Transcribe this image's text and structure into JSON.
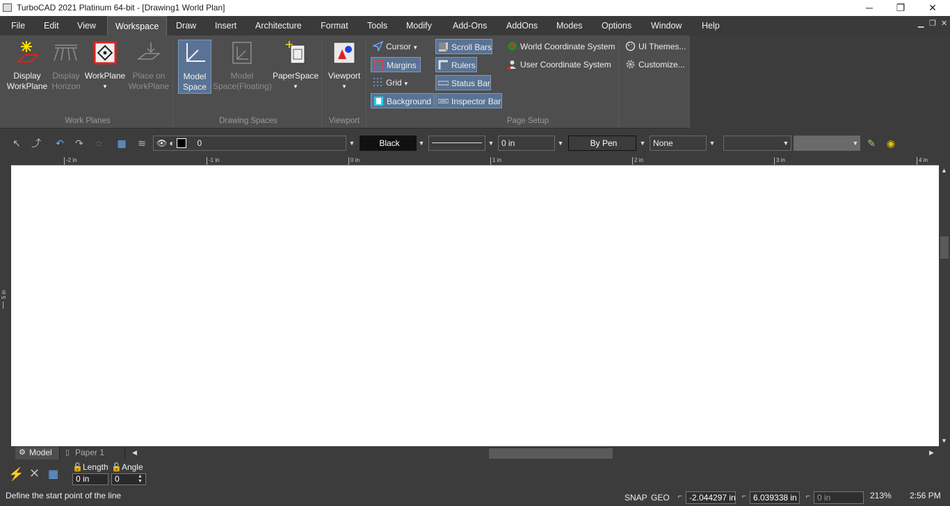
{
  "window": {
    "title": "TurboCAD 2021 Platinum 64-bit - [Drawing1 World Plan]",
    "minimize": "─",
    "restore": "❐",
    "close": "✕"
  },
  "menu": {
    "items": [
      "File",
      "Edit",
      "View",
      "Workspace",
      "Draw",
      "Insert",
      "Architecture",
      "Format",
      "Tools",
      "Modify",
      "Add-Ons",
      "AddOns",
      "Modes",
      "Options",
      "Window",
      "Help"
    ],
    "active": "Workspace"
  },
  "ribbon": {
    "groups": {
      "work_planes": "Work Planes",
      "drawing_spaces": "Drawing Spaces",
      "viewport": "Viewport",
      "page_setup": "Page Setup"
    },
    "display_workplane": [
      "Display",
      "WorkPlane"
    ],
    "display_horizon": [
      "Display",
      "Horizon"
    ],
    "workplane": "WorkPlane",
    "place_on_workplane": [
      "Place on",
      "WorkPlane"
    ],
    "model_space": [
      "Model",
      "Space"
    ],
    "model_space_floating": [
      "Model",
      "Space(Floating)"
    ],
    "paperspace": "PaperSpace",
    "viewport_btn": "Viewport",
    "cursor": "Cursor",
    "margins": "Margins",
    "grid": "Grid",
    "background": "Background",
    "scroll_bars": "Scroll Bars",
    "rulers": "Rulers",
    "status_bar": "Status Bar",
    "inspector_bar": "Inspector Bar",
    "world_cs": "World Coordinate System",
    "user_cs": "User Coordinate System",
    "ui_themes": "UI Themes...",
    "customize": "Customize..."
  },
  "properties": {
    "layer_value": "0",
    "color": "Black",
    "line_width": "0 in",
    "pen_mode": "By Pen",
    "fill": "None"
  },
  "ruler": {
    "ticks": [
      "-2 in",
      "-1 in",
      "0 in",
      "1 in",
      "2 in",
      "3 in",
      "4 in"
    ],
    "left_mark": "5 in"
  },
  "tabs": [
    "Model",
    "Paper 1"
  ],
  "inspector": {
    "length_label": "Length",
    "length_value": "0 in",
    "angle_label": "Angle",
    "angle_value": "0"
  },
  "status": {
    "prompt": "Define the start point of the line",
    "snap": "SNAP",
    "geo": "GEO",
    "x": "-2.044297 in",
    "y": "6.039338 in",
    "z": "0 in",
    "zoom": "213%",
    "time": "2:56 PM"
  },
  "colors": {
    "accent_selected": "#5a7395",
    "ribbon_bg": "#4e4e4e",
    "canvas": "#ffffff"
  }
}
